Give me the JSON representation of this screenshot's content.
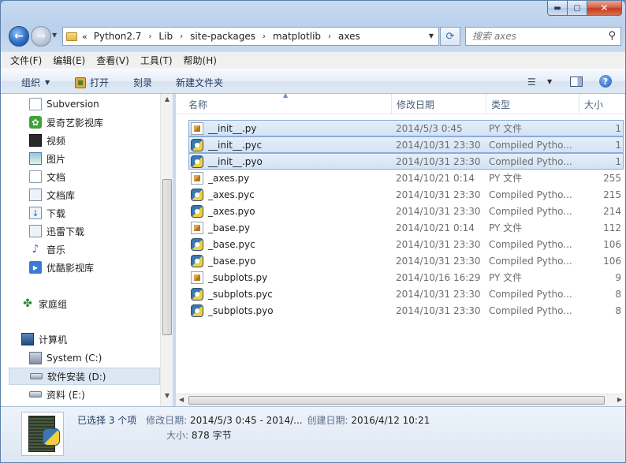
{
  "window": {
    "caption_buttons": {
      "minimize": "▬",
      "maximize": "▢",
      "close": "✕"
    }
  },
  "nav": {
    "back_glyph": "←",
    "forward_glyph": "→",
    "address": {
      "lead": "«",
      "crumbs": [
        "Python2.7",
        "Lib",
        "site-packages",
        "matplotlib",
        "axes"
      ],
      "separator": "›"
    },
    "search_placeholder": "搜索 axes"
  },
  "menu": [
    "文件(F)",
    "编辑(E)",
    "查看(V)",
    "工具(T)",
    "帮助(H)"
  ],
  "toolbar": {
    "organize": "组织",
    "open": "打开",
    "burn": "刻录",
    "new_folder": "新建文件夹"
  },
  "sidebar": {
    "items": [
      {
        "label": "Subversion",
        "icon": "document-icon"
      },
      {
        "label": "爱奇艺影视库",
        "icon": "iqiyi-icon"
      },
      {
        "label": "视频",
        "icon": "video-library-icon"
      },
      {
        "label": "图片",
        "icon": "picture-library-icon"
      },
      {
        "label": "文档",
        "icon": "document-library-icon"
      },
      {
        "label": "文档库",
        "icon": "library-icon"
      },
      {
        "label": "下载",
        "icon": "download-icon"
      },
      {
        "label": "迅雷下载",
        "icon": "xunlei-icon"
      },
      {
        "label": "音乐",
        "icon": "music-icon"
      },
      {
        "label": "优酷影视库",
        "icon": "youku-icon"
      },
      {
        "label": "家庭组",
        "icon": "homegroup-icon"
      },
      {
        "label": "计算机",
        "icon": "computer-icon"
      },
      {
        "label": "System (C:)",
        "icon": "system-drive-icon"
      },
      {
        "label": "软件安装 (D:)",
        "icon": "drive-icon"
      },
      {
        "label": "资料 (E:)",
        "icon": "drive-icon"
      }
    ]
  },
  "columns": {
    "name": "名称",
    "date": "修改日期",
    "type": "类型",
    "size": "大小"
  },
  "files": [
    {
      "name": "__init__.py",
      "date": "2014/5/3 0:45",
      "type": "PY 文件",
      "size": "1",
      "selected": true,
      "kind": "py"
    },
    {
      "name": "__init__.pyc",
      "date": "2014/10/31 23:30",
      "type": "Compiled Pytho...",
      "size": "1",
      "selected": true,
      "kind": "pyc"
    },
    {
      "name": "__init__.pyo",
      "date": "2014/10/31 23:30",
      "type": "Compiled Pytho...",
      "size": "1",
      "selected": true,
      "kind": "pyc"
    },
    {
      "name": "_axes.py",
      "date": "2014/10/21 0:14",
      "type": "PY 文件",
      "size": "255",
      "selected": false,
      "kind": "py"
    },
    {
      "name": "_axes.pyc",
      "date": "2014/10/31 23:30",
      "type": "Compiled Pytho...",
      "size": "215",
      "selected": false,
      "kind": "pyc"
    },
    {
      "name": "_axes.pyo",
      "date": "2014/10/31 23:30",
      "type": "Compiled Pytho...",
      "size": "214",
      "selected": false,
      "kind": "pyc"
    },
    {
      "name": "_base.py",
      "date": "2014/10/21 0:14",
      "type": "PY 文件",
      "size": "112",
      "selected": false,
      "kind": "py"
    },
    {
      "name": "_base.pyc",
      "date": "2014/10/31 23:30",
      "type": "Compiled Pytho...",
      "size": "106",
      "selected": false,
      "kind": "pyc"
    },
    {
      "name": "_base.pyo",
      "date": "2014/10/31 23:30",
      "type": "Compiled Pytho...",
      "size": "106",
      "selected": false,
      "kind": "pyc"
    },
    {
      "name": "_subplots.py",
      "date": "2014/10/16 16:29",
      "type": "PY 文件",
      "size": "9",
      "selected": false,
      "kind": "py"
    },
    {
      "name": "_subplots.pyc",
      "date": "2014/10/31 23:30",
      "type": "Compiled Pytho...",
      "size": "8",
      "selected": false,
      "kind": "pyc"
    },
    {
      "name": "_subplots.pyo",
      "date": "2014/10/31 23:30",
      "type": "Compiled Pytho...",
      "size": "8",
      "selected": false,
      "kind": "pyc"
    }
  ],
  "details": {
    "count": "已选择 3 个项",
    "modified_label": "修改日期:",
    "modified_value": "2014/5/3 0:45 - 2014/...",
    "created_label": "创建日期:",
    "created_value": "2016/4/12 10:21",
    "size_label": "大小:",
    "size_value": "878 字节"
  },
  "colors": {
    "selection_bg": "#d2e2f5",
    "selection_border": "#89acd9",
    "accent": "#2a6bb8"
  }
}
